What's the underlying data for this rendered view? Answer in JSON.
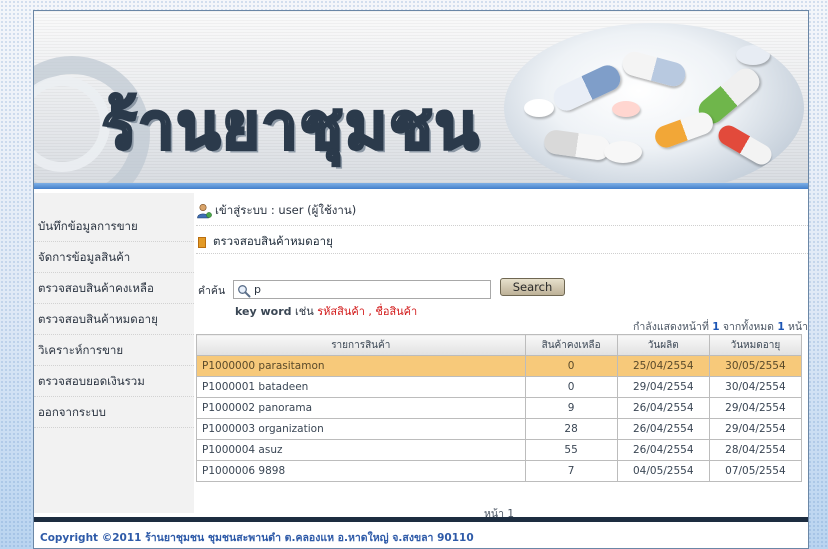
{
  "banner": {
    "logo_text": "ร้านยาชุมชน"
  },
  "nav": {
    "items": [
      {
        "label": "บันทึกข้อมูลการขาย"
      },
      {
        "label": "จัดการข้อมูลสินค้า"
      },
      {
        "label": "ตรวจสอบสินค้าคงเหลือ"
      },
      {
        "label": "ตรวจสอบสินค้าหมดอายุ"
      },
      {
        "label": "วิเคราะห์การขาย"
      },
      {
        "label": "ตรวจสอบยอดเงินรวม"
      },
      {
        "label": "ออกจากระบบ"
      }
    ]
  },
  "login": {
    "text": "เข้าสู่ระบบ : user (ผู้ใช้งาน)",
    "icon": "user-icon"
  },
  "section": {
    "title": "ตรวจสอบสินค้าหมดอายุ",
    "bullet_color": "#e39a26"
  },
  "search": {
    "label": "คำค้น",
    "value": "p",
    "button_label": "Search",
    "hint_keyword": "key word",
    "hint_example": "เช่น",
    "hint_fields": "รหัสสินค้า , ชื่อสินค้า"
  },
  "paging": {
    "prefix": "กำลังแสดงหน้าที่",
    "current": "1",
    "middle": "จากทั้งหมด",
    "total": "1",
    "suffix": "หน้า",
    "footer_label": "หน้า 1"
  },
  "table": {
    "columns": [
      "รายการสินค้า",
      "สินค้าคงเหลือ",
      "วันผลิต",
      "วันหมดอายุ"
    ],
    "rows": [
      {
        "item": "P1000000  parasitamon",
        "stock": "0",
        "mfg": "25/04/2554",
        "exp": "30/05/2554"
      },
      {
        "item": "P1000001  batadeen",
        "stock": "0",
        "mfg": "29/04/2554",
        "exp": "30/04/2554"
      },
      {
        "item": "P1000002  panorama",
        "stock": "9",
        "mfg": "26/04/2554",
        "exp": "29/04/2554"
      },
      {
        "item": "P1000003  organization",
        "stock": "28",
        "mfg": "26/04/2554",
        "exp": "29/04/2554"
      },
      {
        "item": "P1000004  asuz",
        "stock": "55",
        "mfg": "26/04/2554",
        "exp": "28/04/2554"
      },
      {
        "item": "P1000006  9898",
        "stock": "7",
        "mfg": "04/05/2554",
        "exp": "07/05/2554"
      }
    ],
    "highlight_color": "#f7c97a"
  },
  "footer": {
    "copyright": "Copyright ©2011 ร้านยาชุมชน ชุมชนสะพานดำ ต.คลองแห อ.หาดใหญ่ จ.สงขลา 90110"
  }
}
